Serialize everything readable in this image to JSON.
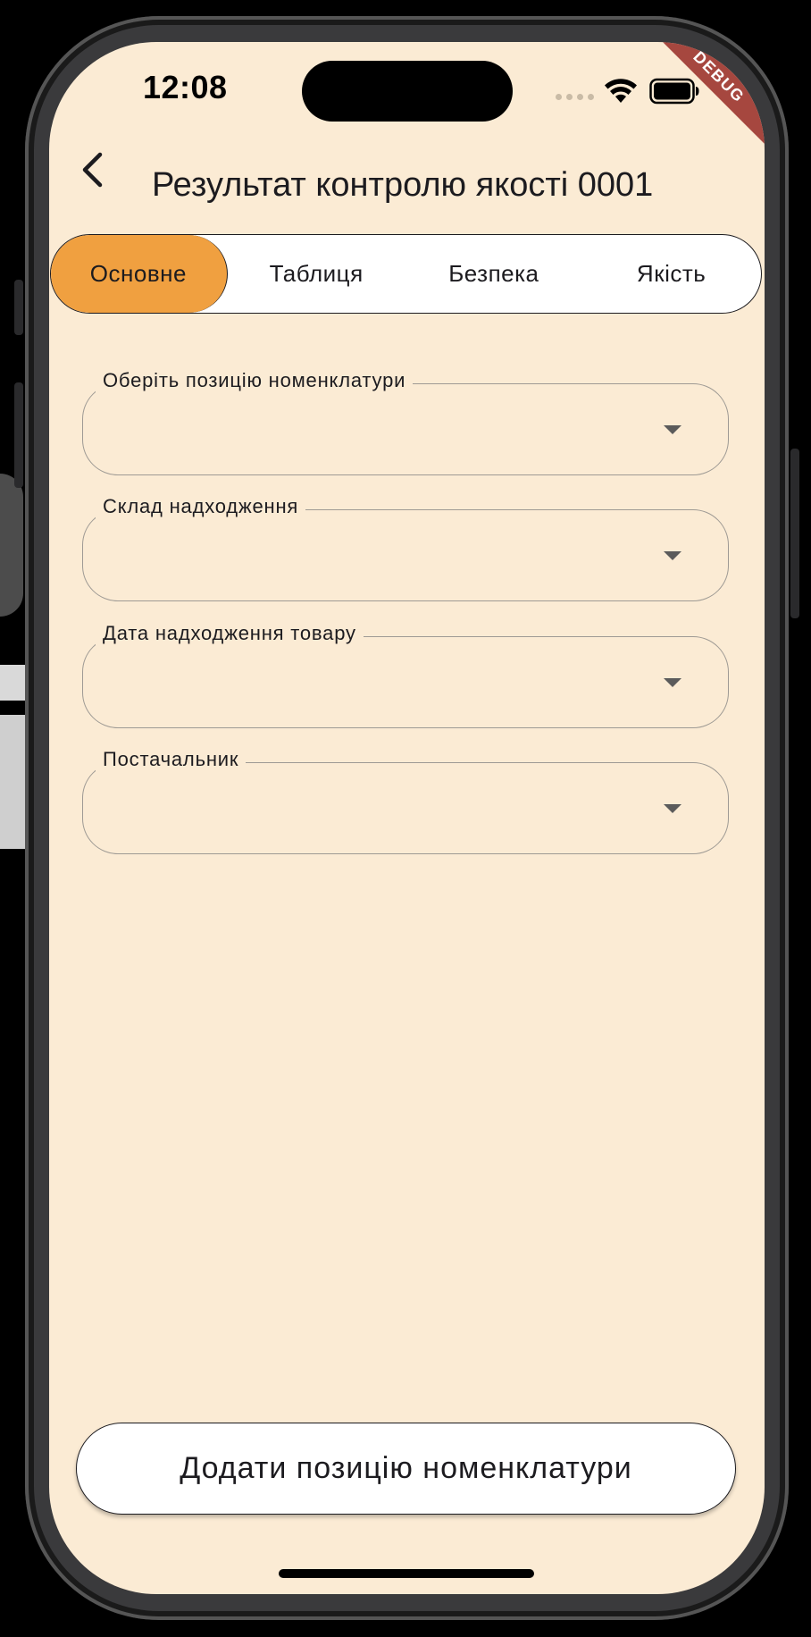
{
  "status_bar": {
    "time": "12:08",
    "debug_label": "DEBUG"
  },
  "app_bar": {
    "title": "Результат контролю якості 0001",
    "back_icon": "chevron-left-icon"
  },
  "tabs": [
    {
      "label": "Основне",
      "active": true
    },
    {
      "label": "Таблиця",
      "active": false
    },
    {
      "label": "Безпека",
      "active": false
    },
    {
      "label": "Якість",
      "active": false
    }
  ],
  "form": {
    "fields": [
      {
        "label": "Оберіть позицію номенклатури",
        "value": ""
      },
      {
        "label": "Склад надходження",
        "value": ""
      },
      {
        "label": "Дата надходження товару",
        "value": ""
      },
      {
        "label": "Постачальник",
        "value": ""
      }
    ]
  },
  "footer": {
    "add_button_label": "Додати позицію номенклатури"
  },
  "colors": {
    "background": "#fbebd4",
    "accent": "#f0a040",
    "debug_ribbon": "#a6473f"
  }
}
